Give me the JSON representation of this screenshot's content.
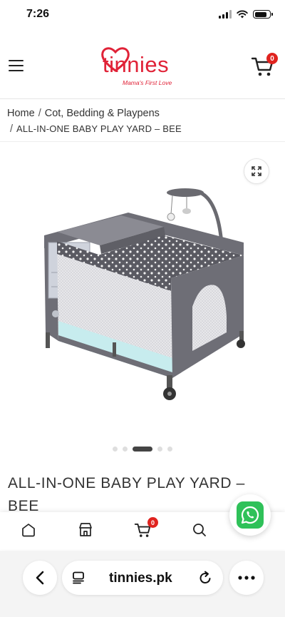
{
  "status_bar": {
    "time": "7:26"
  },
  "header": {
    "logo_text": "tinnies",
    "logo_tagline": "Mama's First Love",
    "cart_count": "0"
  },
  "breadcrumb": {
    "home": "Home",
    "category": "Cot, Bedding & Playpens",
    "current": "ALL-IN-ONE BABY PLAY YARD – BEE"
  },
  "gallery": {
    "slide_count": 5,
    "active_slide": 3
  },
  "product": {
    "title": "ALL-IN-ONE BABY PLAY YARD – BEE"
  },
  "bottom_nav": {
    "cart_count": "0"
  },
  "browser": {
    "url": "tinnies.pk"
  },
  "colors": {
    "brand": "#e02237",
    "whatsapp": "#2fc159",
    "badge": "#e0231f"
  }
}
